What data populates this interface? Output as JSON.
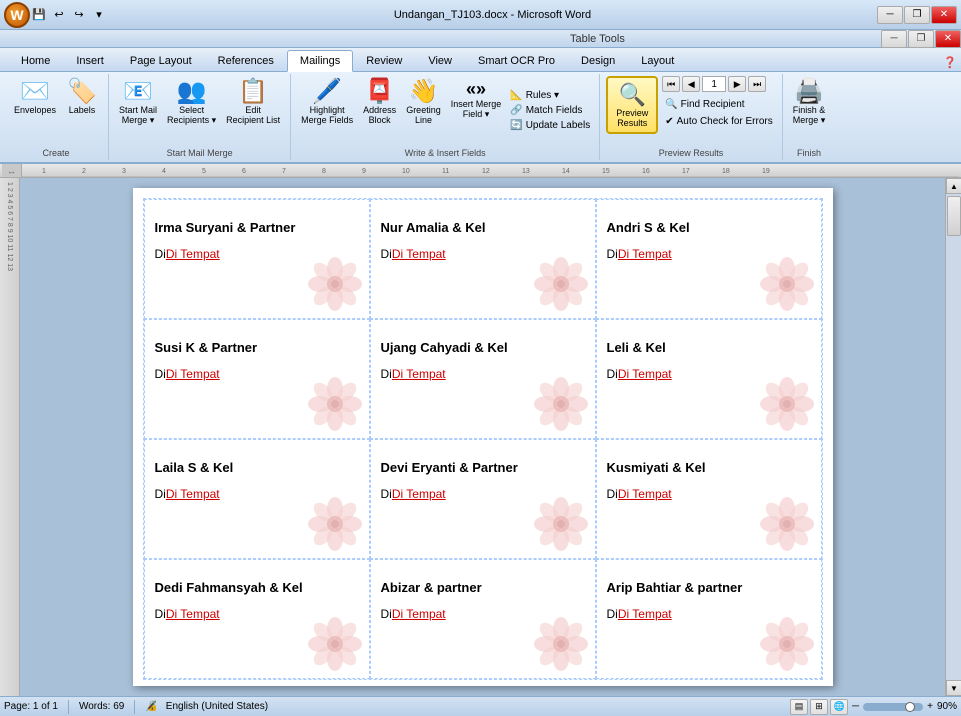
{
  "titleBar": {
    "title": "Undangan_TJ103.docx - Microsoft Word",
    "tableTools": "Table Tools"
  },
  "tabs": {
    "items": [
      "Home",
      "Insert",
      "Page Layout",
      "References",
      "Mailings",
      "Review",
      "View",
      "Smart OCR Pro",
      "Design",
      "Layout"
    ],
    "active": "Mailings"
  },
  "ribbon": {
    "groups": [
      {
        "label": "Create",
        "buttons": [
          {
            "label": "Envelopes",
            "icon": "✉"
          },
          {
            "label": "Labels",
            "icon": "🏷"
          }
        ]
      },
      {
        "label": "Start Mail Merge",
        "buttons": [
          {
            "label": "Start Mail\nMerge ▾",
            "icon": "📧"
          },
          {
            "label": "Select\nRecipients ▾",
            "icon": "👥"
          },
          {
            "label": "Edit\nRecipient List",
            "icon": "📋"
          }
        ]
      },
      {
        "label": "Write & Insert Fields",
        "buttons": [
          {
            "label": "Highlight\nMerge Fields",
            "icon": "🖊"
          },
          {
            "label": "Address\nBlock",
            "icon": "📮"
          },
          {
            "label": "Greeting\nLine",
            "icon": "👋"
          },
          {
            "label": "Insert Merge\nField ▾",
            "icon": "«»"
          }
        ],
        "smallButtons": [
          {
            "label": "Rules ▾",
            "icon": "📐"
          },
          {
            "label": "Match Fields",
            "icon": "🔗"
          },
          {
            "label": "Update Labels",
            "icon": "🔄"
          }
        ]
      },
      {
        "label": "Preview Results",
        "previewBtn": {
          "label": "Preview\nResults",
          "icon": "🔍"
        },
        "navButtons": [
          "◀◀",
          "◀",
          "▶",
          "▶▶"
        ],
        "navValue": "1",
        "smallButtons": [
          {
            "label": "Find Recipient",
            "icon": "🔍"
          },
          {
            "label": "Auto Check for Errors",
            "icon": "✓"
          }
        ]
      },
      {
        "label": "Finish",
        "buttons": [
          {
            "label": "Finish &\nMerge ▾",
            "icon": "🖨"
          }
        ]
      }
    ]
  },
  "document": {
    "labels": [
      {
        "name": "Irma Suryani & Partner",
        "address": "Di Tempat"
      },
      {
        "name": "Nur Amalia & Kel",
        "address": "Di Tempat"
      },
      {
        "name": "Andri S & Kel",
        "address": "Di Tempat"
      },
      {
        "name": "Susi K & Partner",
        "address": "Di Tempat"
      },
      {
        "name": "Ujang Cahyadi & Kel",
        "address": "Di Tempat"
      },
      {
        "name": "Leli & Kel",
        "address": "Di Tempat"
      },
      {
        "name": "Laila S & Kel",
        "address": "Di Tempat"
      },
      {
        "name": "Devi Eryanti & Partner",
        "address": "Di Tempat"
      },
      {
        "name": "Kusmiyati & Kel",
        "address": "Di Tempat"
      },
      {
        "name": "Dedi Fahmansyah & Kel",
        "address": "Di Tempat"
      },
      {
        "name": "Abizar & partner",
        "address": "Di Tempat"
      },
      {
        "name": "Arip Bahtiar & partner",
        "address": "Di Tempat"
      }
    ]
  },
  "statusBar": {
    "page": "Page: 1 of 1",
    "words": "Words: 69",
    "language": "English (United States)",
    "zoom": "90%"
  }
}
